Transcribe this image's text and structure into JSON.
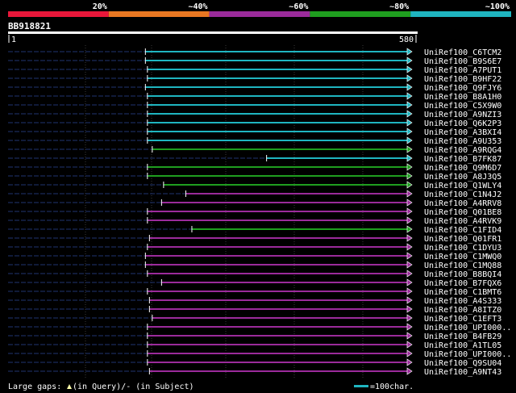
{
  "legend_scale": {
    "labels": [
      "20%",
      "~40%",
      "~60%",
      "~80%",
      "~100%"
    ],
    "colors": [
      "#e8173a",
      "#e87722",
      "#9b2b9b",
      "#1f9e1f",
      "#1fb5c0"
    ]
  },
  "query": {
    "id": "BB918821",
    "start_label": "1",
    "end_label": "580",
    "length": 580
  },
  "hits": [
    {
      "name": "UniRef100_C6TCM2",
      "start": 0.34,
      "color": "#1fb5c0"
    },
    {
      "name": "UniRef100_B9S6E7",
      "start": 0.34,
      "color": "#1fb5c0"
    },
    {
      "name": "UniRef100_A7PUT1",
      "start": 0.345,
      "color": "#1fb5c0"
    },
    {
      "name": "UniRef100_B9HF22",
      "start": 0.345,
      "color": "#1fb5c0"
    },
    {
      "name": "UniRef100_Q9FJY6",
      "start": 0.34,
      "color": "#1fb5c0"
    },
    {
      "name": "UniRef100_B8A1H0",
      "start": 0.345,
      "color": "#1fb5c0"
    },
    {
      "name": "UniRef100_C5X9W0",
      "start": 0.345,
      "color": "#1fb5c0"
    },
    {
      "name": "UniRef100_A9NZI3",
      "start": 0.345,
      "color": "#1fb5c0"
    },
    {
      "name": "UniRef100_Q6K2P3",
      "start": 0.345,
      "color": "#1fb5c0"
    },
    {
      "name": "UniRef100_A3BXI4",
      "start": 0.345,
      "color": "#1fb5c0"
    },
    {
      "name": "UniRef100_A9U353",
      "start": 0.345,
      "color": "#1fb5c0"
    },
    {
      "name": "UniRef100_A9RQG4",
      "start": 0.357,
      "color": "#1f9e1f"
    },
    {
      "name": "UniRef100_B7FK87",
      "start": 0.64,
      "color": "#1fb5c0"
    },
    {
      "name": "UniRef100_Q9M6D7",
      "start": 0.345,
      "color": "#1f9e1f"
    },
    {
      "name": "UniRef100_A8J3Q5",
      "start": 0.345,
      "color": "#1f9e1f"
    },
    {
      "name": "UniRef100_Q1WLY4",
      "start": 0.385,
      "color": "#1f9e1f"
    },
    {
      "name": "UniRef100_C1N4J2",
      "start": 0.44,
      "color": "#9b2b9b"
    },
    {
      "name": "UniRef100_A4RRV8",
      "start": 0.38,
      "color": "#9b2b9b"
    },
    {
      "name": "UniRef100_Q01BE8",
      "start": 0.345,
      "color": "#9b2b9b"
    },
    {
      "name": "UniRef100_A4RVK9",
      "start": 0.345,
      "color": "#9b2b9b"
    },
    {
      "name": "UniRef100_C1FID4",
      "start": 0.455,
      "color": "#1f9e1f"
    },
    {
      "name": "UniRef100_Q01FR1",
      "start": 0.35,
      "color": "#9b2b9b"
    },
    {
      "name": "UniRef100_C1DYU3",
      "start": 0.345,
      "color": "#9b2b9b"
    },
    {
      "name": "UniRef100_C1MWQ0",
      "start": 0.34,
      "color": "#9b2b9b"
    },
    {
      "name": "UniRef100_C1MQ88",
      "start": 0.34,
      "color": "#9b2b9b"
    },
    {
      "name": "UniRef100_B8BQI4",
      "start": 0.345,
      "color": "#9b2b9b"
    },
    {
      "name": "UniRef100_B7FQX6",
      "start": 0.38,
      "color": "#9b2b9b"
    },
    {
      "name": "UniRef100_C1BMT6",
      "start": 0.345,
      "color": "#9b2b9b"
    },
    {
      "name": "UniRef100_A4S333",
      "start": 0.35,
      "color": "#9b2b9b"
    },
    {
      "name": "UniRef100_A8ITZ0",
      "start": 0.35,
      "color": "#9b2b9b"
    },
    {
      "name": "UniRef100_C1EFT3",
      "start": 0.357,
      "color": "#9b2b9b"
    },
    {
      "name": "UniRef100_UPI000..",
      "start": 0.345,
      "color": "#9b2b9b"
    },
    {
      "name": "UniRef100_B4FB29",
      "start": 0.345,
      "color": "#9b2b9b"
    },
    {
      "name": "UniRef100_A1TL05",
      "start": 0.345,
      "color": "#9b2b9b"
    },
    {
      "name": "UniRef100_UPI000..",
      "start": 0.345,
      "color": "#9b2b9b"
    },
    {
      "name": "UniRef100_Q9SU04",
      "start": 0.345,
      "color": "#9b2b9b"
    },
    {
      "name": "UniRef100_A9NT43",
      "start": 0.35,
      "color": "#9b2b9b"
    }
  ],
  "footer": {
    "gap_text_prefix": "Large gaps: ",
    "gap_text_query": "(in Query)/- (in Subject)",
    "scale_text": "=100char."
  }
}
